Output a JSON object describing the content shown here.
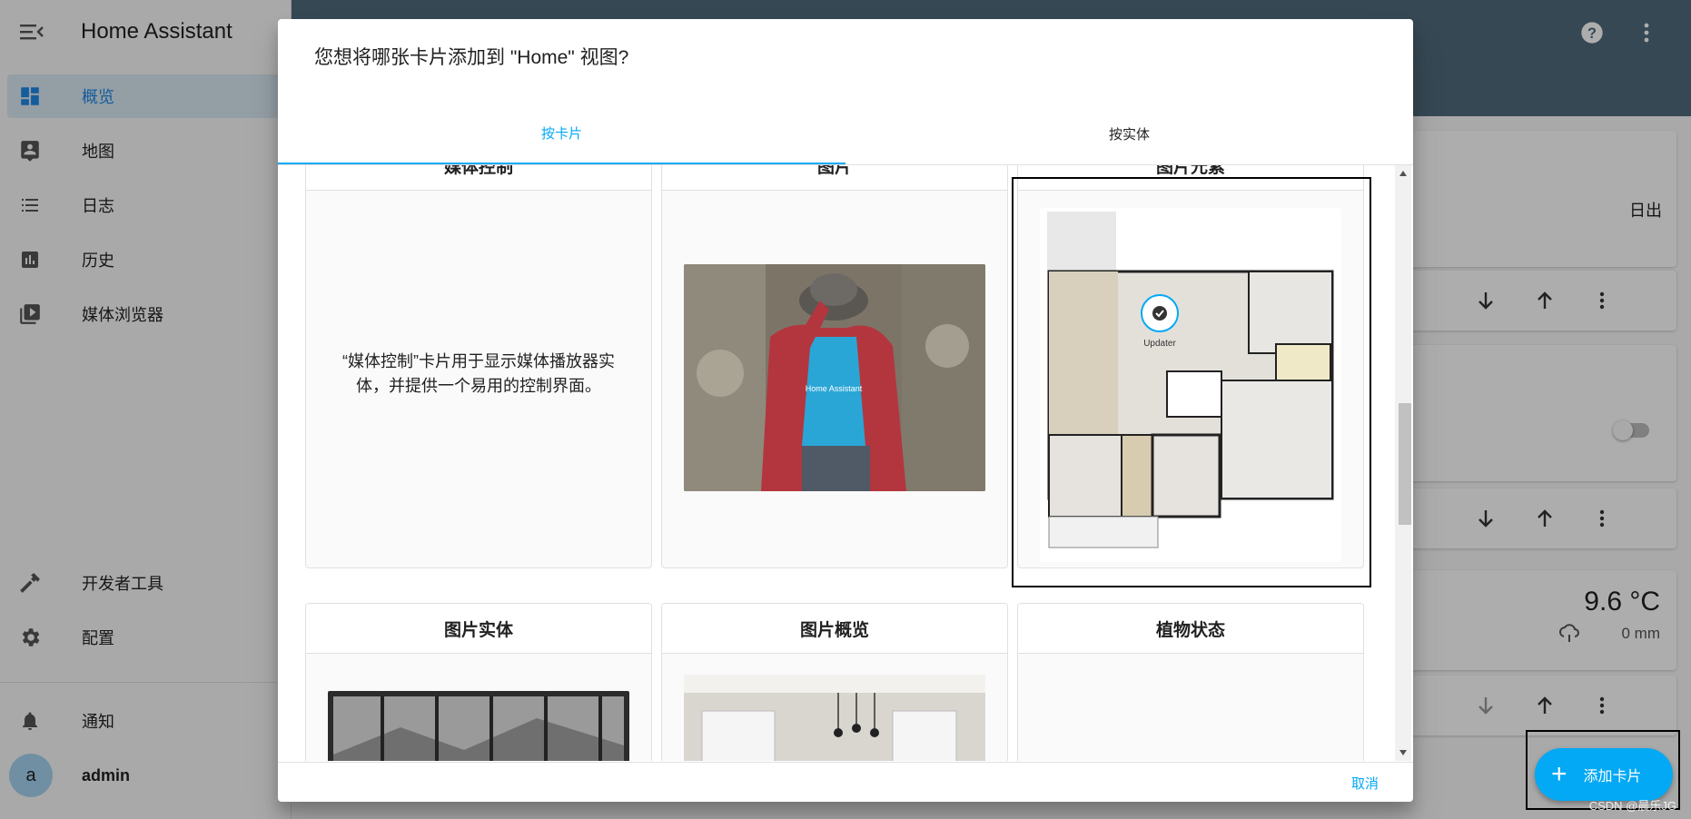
{
  "app": {
    "title": "Home Assistant"
  },
  "sidebar": {
    "items": [
      {
        "label": "概览",
        "icon": "dashboard-icon"
      },
      {
        "label": "地图",
        "icon": "map-icon"
      },
      {
        "label": "日志",
        "icon": "logbook-icon"
      },
      {
        "label": "历史",
        "icon": "history-icon"
      },
      {
        "label": "媒体浏览器",
        "icon": "media-browser-icon"
      },
      {
        "label": "开发者工具",
        "icon": "hammer-icon"
      },
      {
        "label": "配置",
        "icon": "gear-icon"
      },
      {
        "label": "通知",
        "icon": "bell-icon"
      }
    ],
    "user": {
      "initial": "a",
      "name": "admin"
    }
  },
  "background": {
    "sun_state": "日出",
    "temperature": "9.6 °C",
    "precipitation": "0 mm",
    "fab_label": "添加卡片",
    "watermark": "CSDN @晨乐JG"
  },
  "dialog": {
    "title": "您想将哪张卡片添加到 \"Home\" 视图?",
    "tabs": [
      {
        "label": "按卡片",
        "active": true
      },
      {
        "label": "按实体",
        "active": false
      }
    ],
    "cards_row1": [
      {
        "title": "媒体控制",
        "description": "“媒体控制”卡片用于显示媒体播放器实体，并提供一个易用的控制界面。"
      },
      {
        "title": "图片"
      },
      {
        "title": "图片元素",
        "badge_label": "Updater"
      }
    ],
    "cards_row2": [
      {
        "title": "图片实体"
      },
      {
        "title": "图片概览"
      },
      {
        "title": "植物状态"
      }
    ],
    "preview_texts": {
      "shirt_text": "Home Assistant"
    },
    "cancel_label": "取消"
  },
  "colors": {
    "accent": "#03a9f4",
    "header": "#4f6a7b",
    "active_item_bg": "#dbe9f4"
  }
}
